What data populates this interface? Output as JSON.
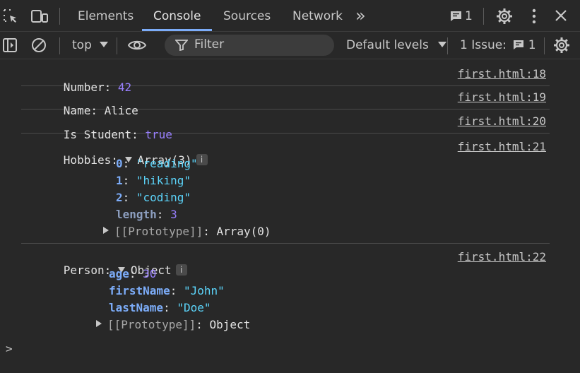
{
  "tabs": {
    "elements": "Elements",
    "console": "Console",
    "sources": "Sources",
    "network": "Network",
    "more": "»"
  },
  "header": {
    "messages_count": "1"
  },
  "toolbar": {
    "context": "top",
    "filter_placeholder": "Filter",
    "levels": "Default levels",
    "issues_label": "1 Issue:",
    "issues_count": "1"
  },
  "console": {
    "number": {
      "label": "Number:",
      "value": "42",
      "source": "first.html:18"
    },
    "name": {
      "label": "Name:",
      "value": "Alice",
      "source": "first.html:19"
    },
    "student": {
      "label": "Is Student:",
      "value": "true",
      "source": "first.html:20"
    },
    "hobbies": {
      "label": "Hobbies:",
      "summary": "Array(3)",
      "info": "i",
      "source": "first.html:21",
      "items": [
        {
          "key": "0",
          "value": "\"reading\""
        },
        {
          "key": "1",
          "value": "\"hiking\""
        },
        {
          "key": "2",
          "value": "\"coding\""
        }
      ],
      "length_key": "length",
      "length_value": "3",
      "proto_key": "[[Prototype]]",
      "proto_value": "Array(0)"
    },
    "person": {
      "label": "Person:",
      "summary": "Object",
      "info": "i",
      "source": "first.html:22",
      "props": [
        {
          "key": "age",
          "value": "30",
          "kind": "num"
        },
        {
          "key": "firstName",
          "value": "\"John\"",
          "kind": "str"
        },
        {
          "key": "lastName",
          "value": "\"Doe\"",
          "kind": "str"
        }
      ],
      "proto_key": "[[Prototype]]",
      "proto_value": "Object"
    },
    "prompt": ">"
  }
}
